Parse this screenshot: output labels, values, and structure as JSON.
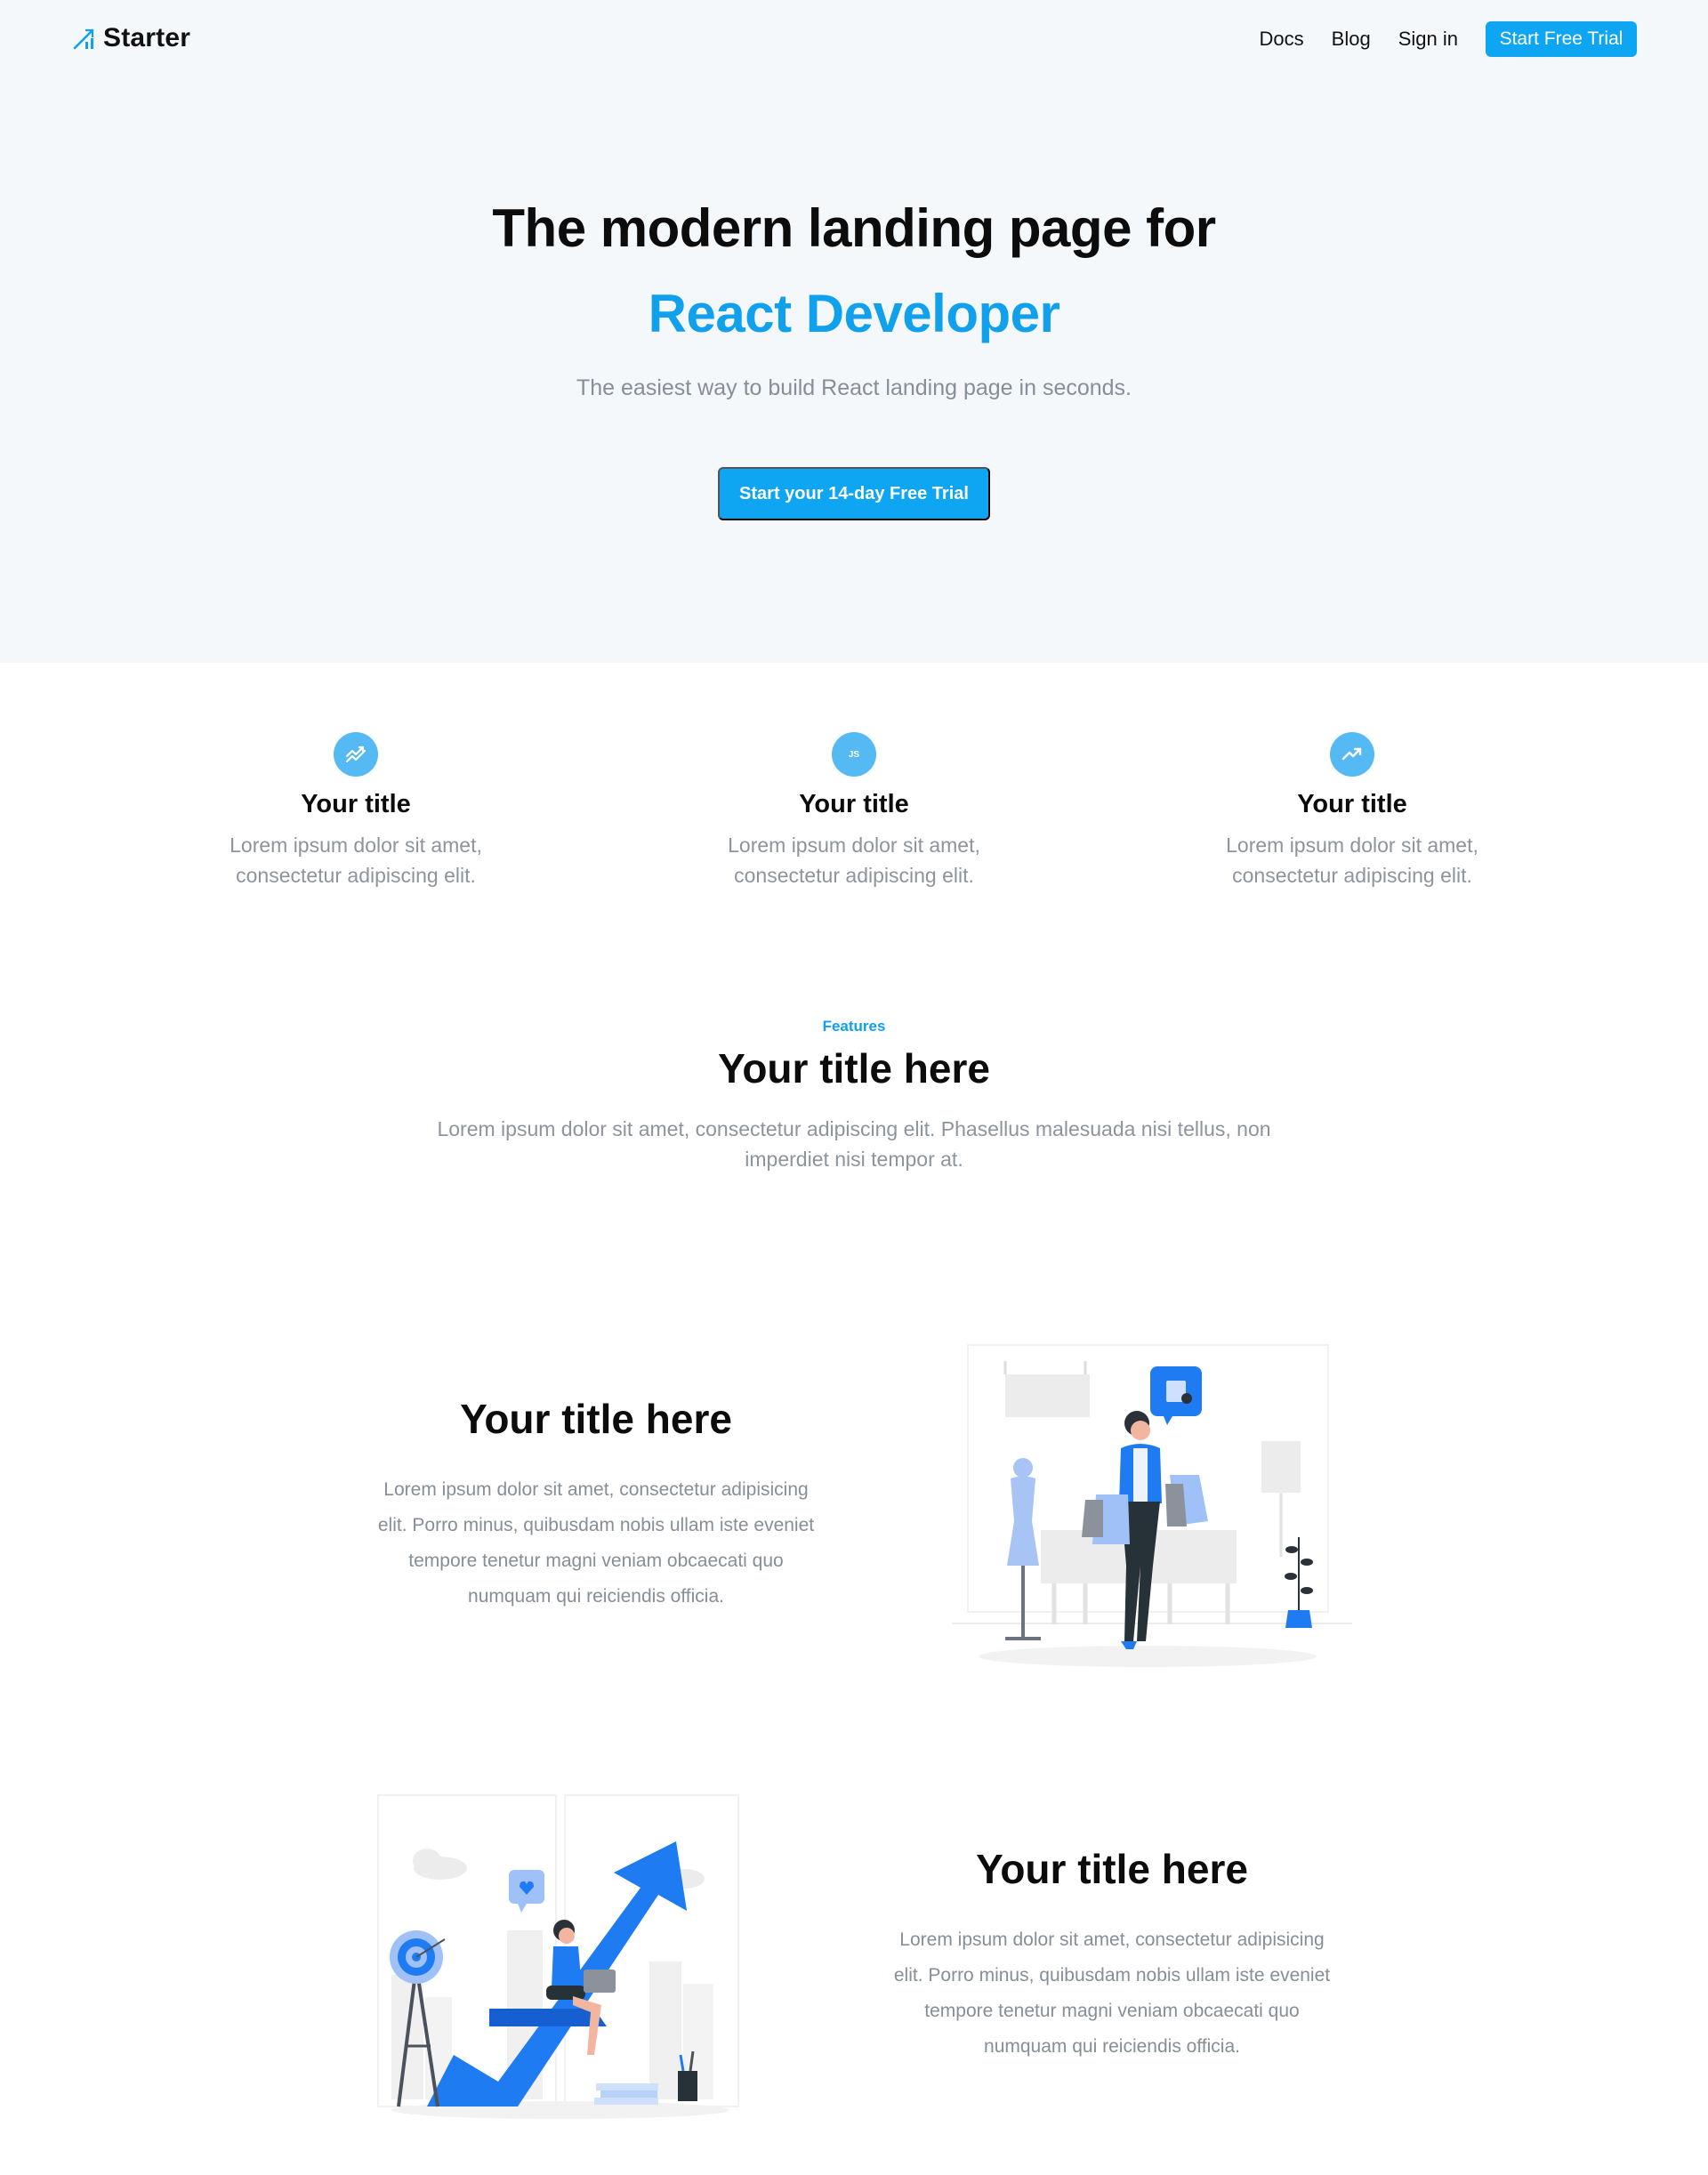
{
  "brand": {
    "name": "Starter",
    "logo_icon": "bar-chart-icon",
    "accent": "#0ea5f3",
    "hero_bg": "#f5f8fb"
  },
  "nav": {
    "links": [
      "Docs",
      "Blog",
      "Sign in"
    ],
    "cta": "Start Free Trial"
  },
  "hero": {
    "title_line1": "The modern landing page for",
    "title_line2": "React Developer",
    "subtitle": "The easiest way to build React landing page in seconds.",
    "cta": "Start your 14-day Free Trial"
  },
  "features_grid": [
    {
      "icon": "double-trend-icon",
      "title": "Your title",
      "desc_line1": "Lorem ipsum dolor sit amet,",
      "desc_line2": "consectetur adipiscing elit."
    },
    {
      "icon": "js-icon",
      "icon_text": "JS",
      "title": "Your title",
      "desc_line1": "Lorem ipsum dolor sit amet,",
      "desc_line2": "consectetur adipiscing elit."
    },
    {
      "icon": "trending-up-icon",
      "title": "Your title",
      "desc_line1": "Lorem ipsum dolor sit amet,",
      "desc_line2": "consectetur adipiscing elit."
    }
  ],
  "features_section": {
    "label": "Features",
    "title": "Your title here",
    "desc_line1": "Lorem ipsum dolor sit amet, consectetur adipiscing elit. Phasellus malesuada nisi tellus, non",
    "desc_line2": "imperdiet nisi tempor at."
  },
  "rows": [
    {
      "title": "Your title here",
      "desc_lines": [
        "Lorem ipsum dolor sit amet, consectetur adipisicing",
        "elit. Porro minus, quibusdam nobis ullam iste eveniet",
        "tempore tenetur magni veniam obcaecati quo",
        "numquam qui reiciendis officia."
      ],
      "illustration": "shopping-woman-illustration"
    },
    {
      "title": "Your title here",
      "desc_lines": [
        "Lorem ipsum dolor sit amet, consectetur adipisicing",
        "elit. Porro minus, quibusdam nobis ullam iste eveniet",
        "tempore tenetur magni veniam obcaecati quo",
        "numquam qui reiciendis officia."
      ],
      "illustration": "growth-arrow-illustration"
    }
  ]
}
